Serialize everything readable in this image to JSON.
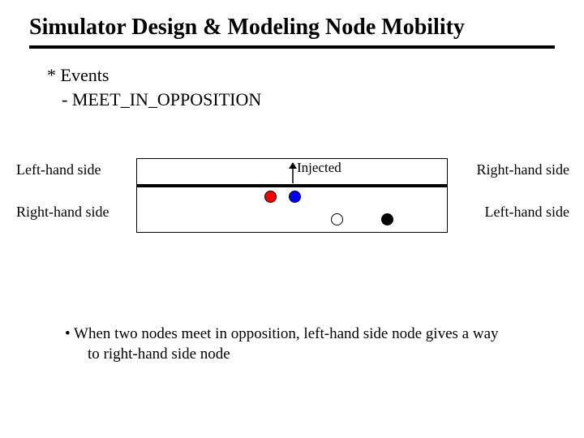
{
  "title": "Simulator Design & Modeling Node Mobility",
  "events_heading": "* Events",
  "event_item": "- MEET_IN_OPPOSITION",
  "labels": {
    "left_top": "Left-hand side",
    "right_top": "Right-hand side",
    "left_bottom": "Right-hand side",
    "right_bottom": "Left-hand side",
    "injected": "Injected"
  },
  "note_line1": "• When two nodes meet in opposition, left-hand side node gives a way",
  "note_line2": "to right-hand side node",
  "colors": {
    "red": "#ff0000",
    "blue": "#0000ff",
    "black": "#000000",
    "white": "#ffffff"
  }
}
